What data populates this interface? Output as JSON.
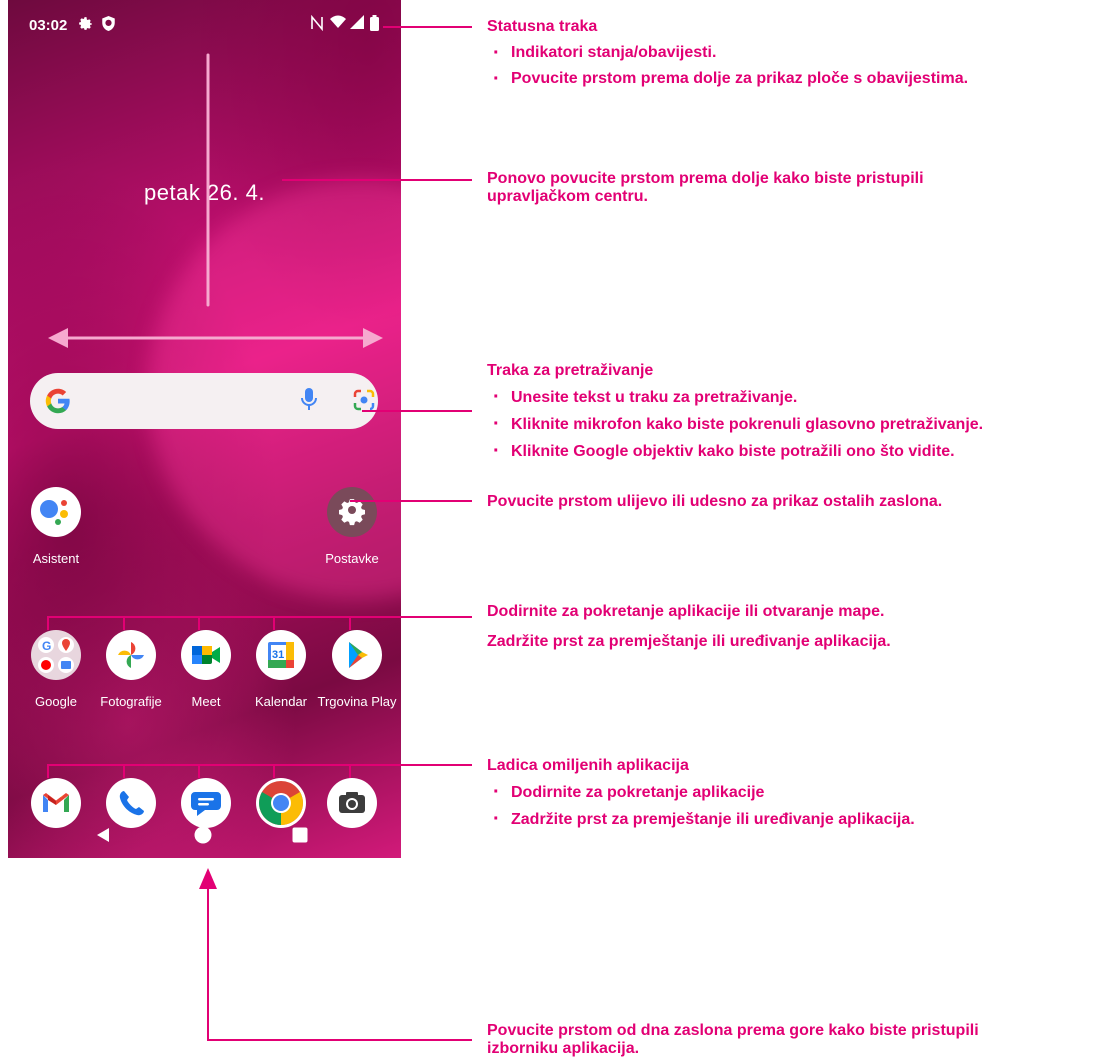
{
  "status_bar": {
    "time": "03:02",
    "left_icons": [
      "gear-icon",
      "shield-icon"
    ],
    "right_icons": [
      "nfc-icon",
      "wifi-icon",
      "signal-icon",
      "battery-icon"
    ]
  },
  "home": {
    "date": "petak 26. 4."
  },
  "search_bar": {
    "icons": [
      "google-g-icon",
      "microphone-icon",
      "google-lens-icon"
    ]
  },
  "apps_row1": [
    {
      "label": "Asistent",
      "icon": "google-assistant-icon"
    },
    {
      "label": "Postavke",
      "icon": "settings-icon"
    }
  ],
  "apps_row2": [
    {
      "label": "Google",
      "icon": "google-folder-icon"
    },
    {
      "label": "Fotografije",
      "icon": "google-photos-icon"
    },
    {
      "label": "Meet",
      "icon": "google-meet-icon"
    },
    {
      "label": "Kalendar",
      "icon": "google-calendar-icon",
      "day": "31"
    },
    {
      "label": "Trgovina Play",
      "icon": "play-store-icon"
    }
  ],
  "dock": [
    {
      "icon": "gmail-icon"
    },
    {
      "icon": "phone-icon"
    },
    {
      "icon": "messages-icon"
    },
    {
      "icon": "chrome-icon"
    },
    {
      "icon": "camera-icon"
    }
  ],
  "nav_bar": {
    "icons": [
      "back-icon",
      "home-icon",
      "recents-icon"
    ]
  },
  "annotations": {
    "status": {
      "title": "Statusna traka",
      "bullets": [
        "Indikatori stanja/obavijesti.",
        "Povucite prstom prema dolje za prikaz ploče s obavijestima."
      ]
    },
    "control": {
      "line1": "Ponovo povucite prstom prema dolje kako biste pristupili",
      "line2": "upravljačkom centru."
    },
    "search": {
      "title": "Traka za pretraživanje",
      "bullets": [
        "Unesite tekst u traku za pretraživanje.",
        "Kliknite mikrofon kako biste pokrenuli glasovno pretraživanje.",
        "Kliknite Google objektiv kako biste potražili ono što vidite."
      ]
    },
    "swipe": {
      "text": "Povucite prstom ulijevo ili udesno za prikaz ostalih zaslona."
    },
    "apps": {
      "line1": "Dodirnite za pokretanje aplikacije ili otvaranje mape.",
      "line2": "Zadržite prst za premještanje ili uređivanje aplikacija."
    },
    "favorites": {
      "title": "Ladica omiljenih aplikacija",
      "bullets": [
        "Dodirnite za pokretanje aplikacije",
        "Zadržite prst za premještanje ili uređivanje aplikacija."
      ]
    },
    "drawer": {
      "line1": "Povucite prstom od dna zaslona prema gore kako biste pristupili",
      "line2": "izborniku aplikacija."
    }
  },
  "colors": {
    "accent": "#e20074",
    "wallpaper_dark": "#7a0a42",
    "wallpaper_bright": "#e0147f"
  }
}
